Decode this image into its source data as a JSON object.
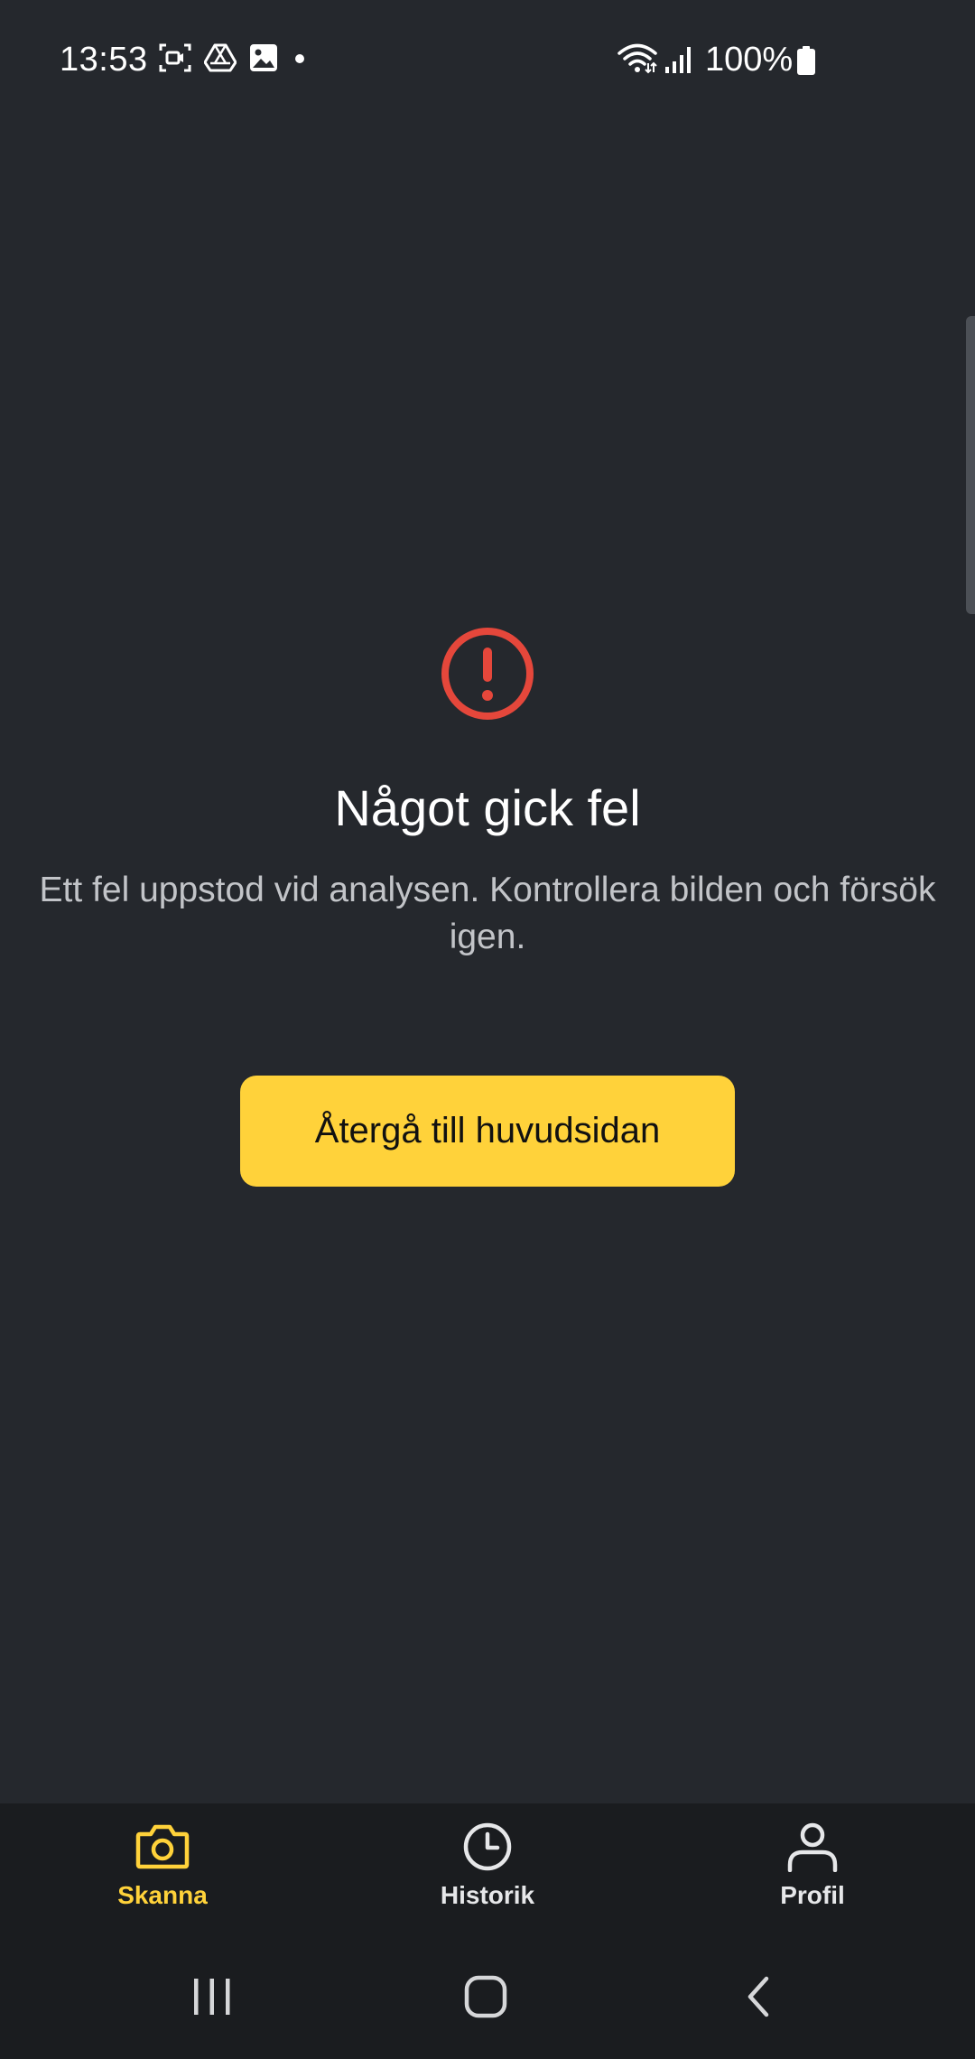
{
  "status_bar": {
    "time": "13:53",
    "battery_percent": "100%",
    "icons_left": [
      "screen-record-icon",
      "drive-icon",
      "gallery-icon",
      "notification-dot-icon"
    ],
    "icons_right": [
      "wifi-icon",
      "signal-icon",
      "battery-icon"
    ]
  },
  "error": {
    "icon": "error-exclamation-icon",
    "icon_color": "#e5473b",
    "title": "Något gick fel",
    "message": "Ett fel uppstod vid analysen. Kontrollera bilden och försök igen.",
    "button_label": "Återgå till huvudsidan",
    "button_color": "#ffd23a"
  },
  "bottom_nav": {
    "items": [
      {
        "label": "Skanna",
        "icon": "camera-icon",
        "active": true
      },
      {
        "label": "Historik",
        "icon": "clock-icon",
        "active": false
      },
      {
        "label": "Profil",
        "icon": "person-icon",
        "active": false
      }
    ],
    "active_color": "#ffd23a"
  },
  "system_nav": {
    "buttons": [
      "recent-apps-icon",
      "home-icon",
      "back-icon"
    ]
  }
}
